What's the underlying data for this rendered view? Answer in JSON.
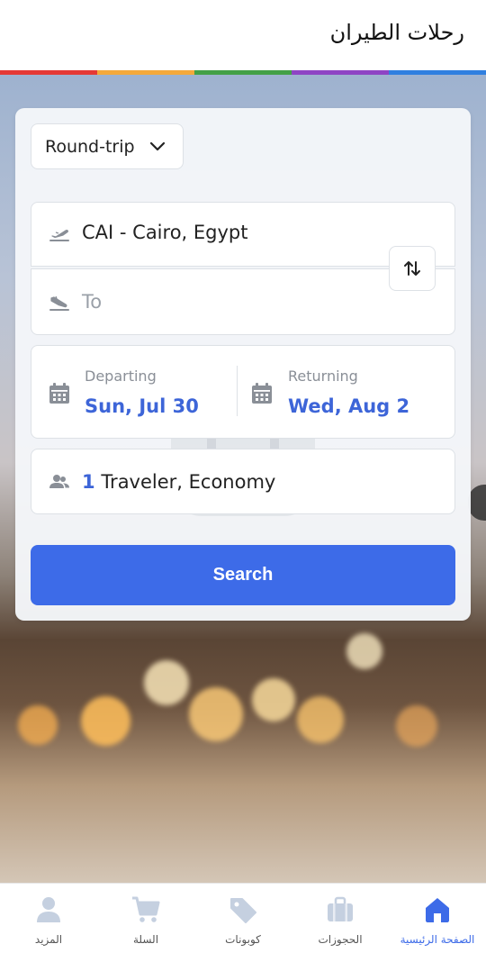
{
  "header": {
    "title": "رحلات الطيران"
  },
  "colors": {
    "strip": [
      "#e53935",
      "#f4a93b",
      "#43a047",
      "#8e44c4",
      "#2f7fe0"
    ],
    "accent": "#3d6be8",
    "date_text": "#3d65d8"
  },
  "search_form": {
    "trip_type": "Round-trip",
    "from": {
      "value": "CAI - Cairo, Egypt",
      "icon": "plane-takeoff-icon"
    },
    "to": {
      "placeholder": "To",
      "icon": "plane-landing-icon"
    },
    "swap_icon": "swap-vertical-icon",
    "departing": {
      "label": "Departing",
      "value": "Sun, Jul 30"
    },
    "returning": {
      "label": "Returning",
      "value": "Wed, Aug 2"
    },
    "travelers": {
      "count": "1",
      "text": "Traveler, Economy"
    },
    "search_label": "Search"
  },
  "bottom_nav": {
    "items": [
      {
        "label": "الصفحة الرئيسية",
        "icon": "home-icon",
        "active": true
      },
      {
        "label": "الحجوزات",
        "icon": "briefcase-icon",
        "active": false
      },
      {
        "label": "كوبونات",
        "icon": "tag-icon",
        "active": false
      },
      {
        "label": "السلة",
        "icon": "cart-icon",
        "active": false
      },
      {
        "label": "المزيد",
        "icon": "user-icon",
        "active": false
      }
    ]
  }
}
